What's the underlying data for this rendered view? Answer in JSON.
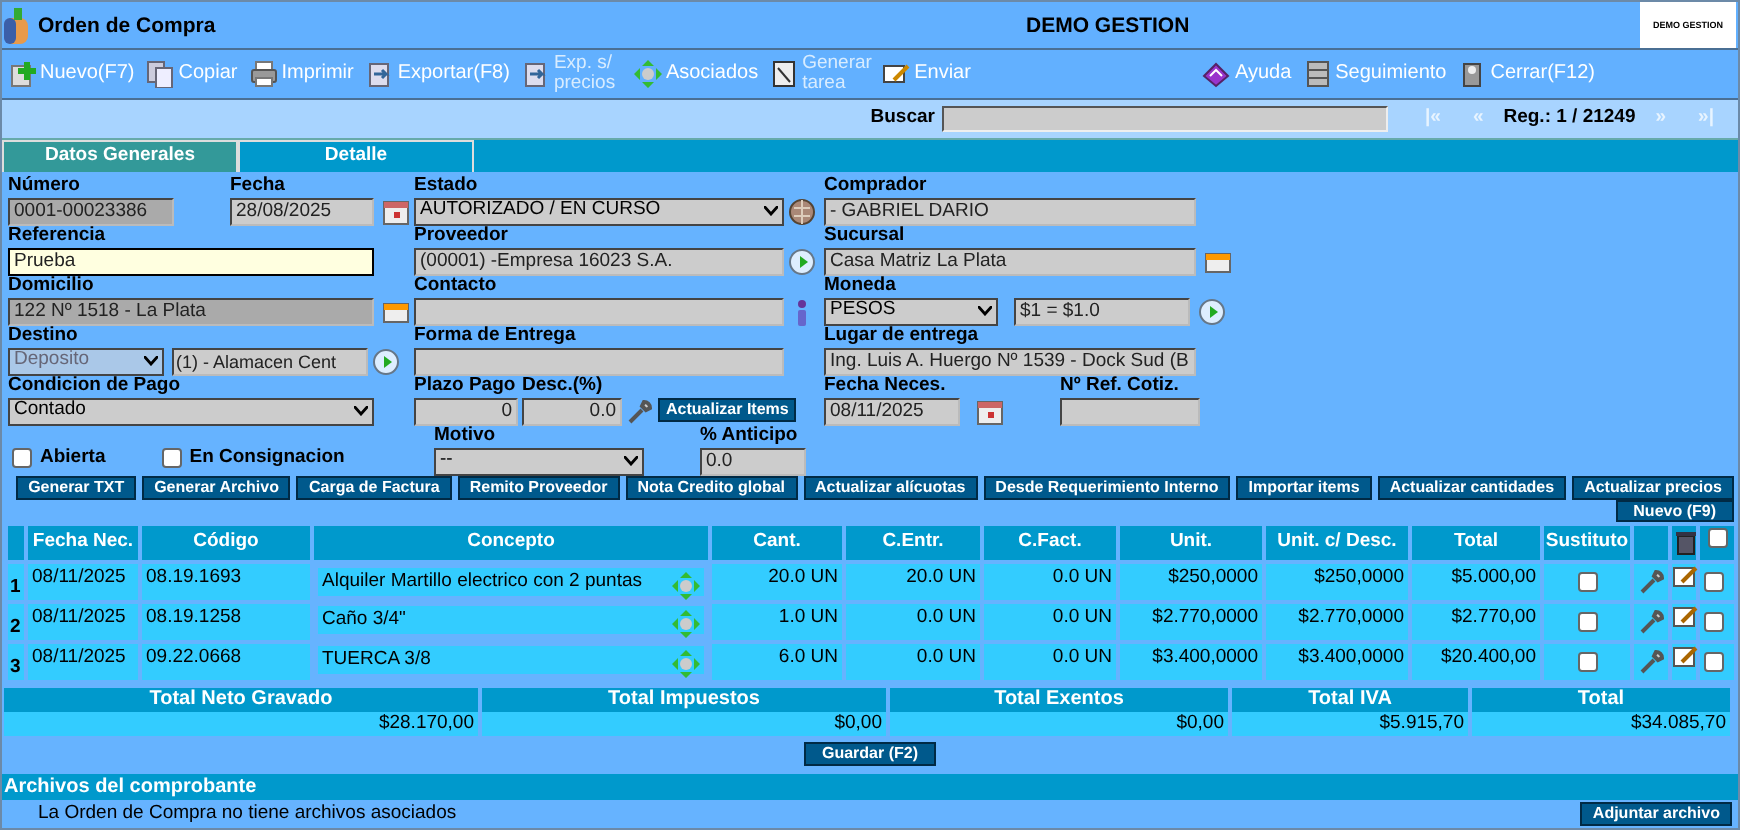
{
  "window": {
    "title": "Orden de Compra",
    "company": "DEMO GESTION",
    "logo_text": "DEMO GESTION"
  },
  "toolbar": {
    "left": [
      {
        "label": "Nuevo(F7)",
        "kind": "new",
        "disabled": false
      },
      {
        "label": "Copiar",
        "kind": "copy",
        "disabled": false
      },
      {
        "label": "Imprimir",
        "kind": "print",
        "disabled": false
      },
      {
        "label": "Exportar(F8)",
        "kind": "export",
        "disabled": false
      },
      {
        "label": "Exp. s/ precios",
        "kind": "export",
        "disabled": true
      },
      {
        "label": "Asociados",
        "kind": "link",
        "disabled": false
      },
      {
        "label": "Generar tarea",
        "kind": "task",
        "disabled": true
      },
      {
        "label": "Enviar",
        "kind": "send",
        "disabled": false
      }
    ],
    "right": [
      {
        "label": "Ayuda",
        "kind": "help",
        "disabled": false
      },
      {
        "label": "Seguimiento",
        "kind": "track",
        "disabled": false
      },
      {
        "label": "Cerrar(F12)",
        "kind": "close",
        "disabled": false
      }
    ]
  },
  "search": {
    "label": "Buscar",
    "first": "|«",
    "prev": "«",
    "record": "Reg.: 1 / 21249",
    "next": "»",
    "last": "»|"
  },
  "tabs": [
    {
      "label": "Datos Generales",
      "selected": true
    },
    {
      "label": "Detalle",
      "selected": false
    }
  ],
  "form": {
    "numero": {
      "label": "Número",
      "value": "0001-00023386",
      "readonly": true,
      "focused": false
    },
    "fecha": {
      "label": "Fecha",
      "value": "28/08/2025",
      "readonly": false,
      "focused": false
    },
    "estado": {
      "label": "Estado",
      "value": "AUTORIZADO / EN CURSO",
      "disabled": false
    },
    "comprador": {
      "label": "Comprador",
      "value": "- GABRIEL DARIO",
      "readonly": false,
      "focused": false
    },
    "referencia": {
      "label": "Referencia",
      "value": "Prueba",
      "readonly": false,
      "focused": true
    },
    "proveedor": {
      "label": "Proveedor",
      "value": "(00001) -Empresa 16023 S.A.",
      "readonly": false,
      "focused": false
    },
    "sucursal": {
      "label": "Sucursal",
      "value": "Casa Matriz La Plata",
      "readonly": false,
      "focused": false
    },
    "domicilio": {
      "label": "Domicilio",
      "value": "122 Nº 1518 - La Plata",
      "readonly": true,
      "focused": false
    },
    "contacto": {
      "label": "Contacto",
      "readonly": false,
      "focused": false
    },
    "moneda": {
      "label": "Moneda",
      "value": "PESOS",
      "rate": "$1 = $1.0",
      "disabled": false
    },
    "destino": {
      "label": "Destino",
      "value": "Deposito",
      "disabled": true,
      "location": "(1) - Alamacen Cent"
    },
    "forma_entrega": {
      "label": "Forma de Entrega",
      "readonly": false,
      "focused": false
    },
    "lugar_entrega": {
      "label": "Lugar de entrega",
      "value": "Ing. Luis A. Huergo Nº 1539 - Dock Sud (B",
      "readonly": false,
      "focused": false
    },
    "condicion_pago": {
      "label": "Condicion de Pago",
      "value": "Contado",
      "disabled": false
    },
    "plazo_pago": {
      "label": "Plazo Pago",
      "value": "0",
      "readonly": false,
      "focused": false
    },
    "descuento": {
      "label": "Desc.(%)",
      "value": "0.0",
      "readonly": false,
      "focused": false
    },
    "actualizar_items": "Actualizar Items",
    "fecha_neces": {
      "label": "Fecha Neces.",
      "value": "08/11/2025",
      "readonly": false,
      "focused": false
    },
    "ref_cotiz": {
      "label": "Nº Ref. Cotiz.",
      "readonly": false,
      "focused": false
    },
    "abierta": {
      "label": "Abierta",
      "checked": false
    },
    "consignacion": {
      "label": "En Consignacion",
      "checked": false
    },
    "motivo": {
      "label": "Motivo",
      "value": "--",
      "disabled": false
    },
    "anticipo": {
      "label": "% Anticipo",
      "value": "0.0",
      "readonly": false,
      "focused": false
    }
  },
  "actions": [
    "Generar TXT",
    "Generar Archivo",
    "Carga de Factura",
    "Remito Proveedor",
    "Nota Credito global",
    "Actualizar alícuotas",
    "Desde Requerimiento Interno",
    "Importar items",
    "Actualizar cantidades",
    "Actualizar precios"
  ],
  "new_item": "Nuevo (F9)",
  "table": {
    "columns": [
      "Fecha Nec.",
      "Código",
      "Concepto",
      "Cant.",
      "C.Entr.",
      "C.Fact.",
      "Unit.",
      "Unit. c/ Desc.",
      "Total",
      "Sustituto"
    ],
    "select_all": false,
    "rows": [
      {
        "n": "1",
        "cells": [
          "08/11/2025",
          "08.19.1693",
          "Alquiler Martillo electrico con 2 puntas",
          "20.0 UN",
          "20.0 UN",
          "0.0 UN",
          "$250,0000",
          "$250,0000",
          "$5.000,00"
        ],
        "sustituto": false,
        "selected": false
      },
      {
        "n": "2",
        "cells": [
          "08/11/2025",
          "08.19.1258",
          "Caño 3/4\"",
          "1.0 UN",
          "0.0 UN",
          "0.0 UN",
          "$2.770,0000",
          "$2.770,0000",
          "$2.770,00"
        ],
        "sustituto": false,
        "selected": false
      },
      {
        "n": "3",
        "cells": [
          "08/11/2025",
          "09.22.0668",
          "TUERCA 3/8",
          "6.0 UN",
          "0.0 UN",
          "0.0 UN",
          "$3.400,0000",
          "$3.400,0000",
          "$20.400,00"
        ],
        "sustituto": false,
        "selected": false
      }
    ]
  },
  "totals": [
    {
      "label": "Total Neto Gravado",
      "value": "$28.170,00"
    },
    {
      "label": "Total Impuestos",
      "value": "$0,00"
    },
    {
      "label": "Total Exentos",
      "value": "$0,00"
    },
    {
      "label": "Total IVA",
      "value": "$5.915,70"
    },
    {
      "label": "Total",
      "value": "$34.085,70"
    }
  ],
  "save": "Guardar (F2)",
  "files": {
    "title": "Archivos del comprobante",
    "message": "La Orden de Compra no tiene archivos asociados",
    "attach": "Adjuntar archivo"
  }
}
